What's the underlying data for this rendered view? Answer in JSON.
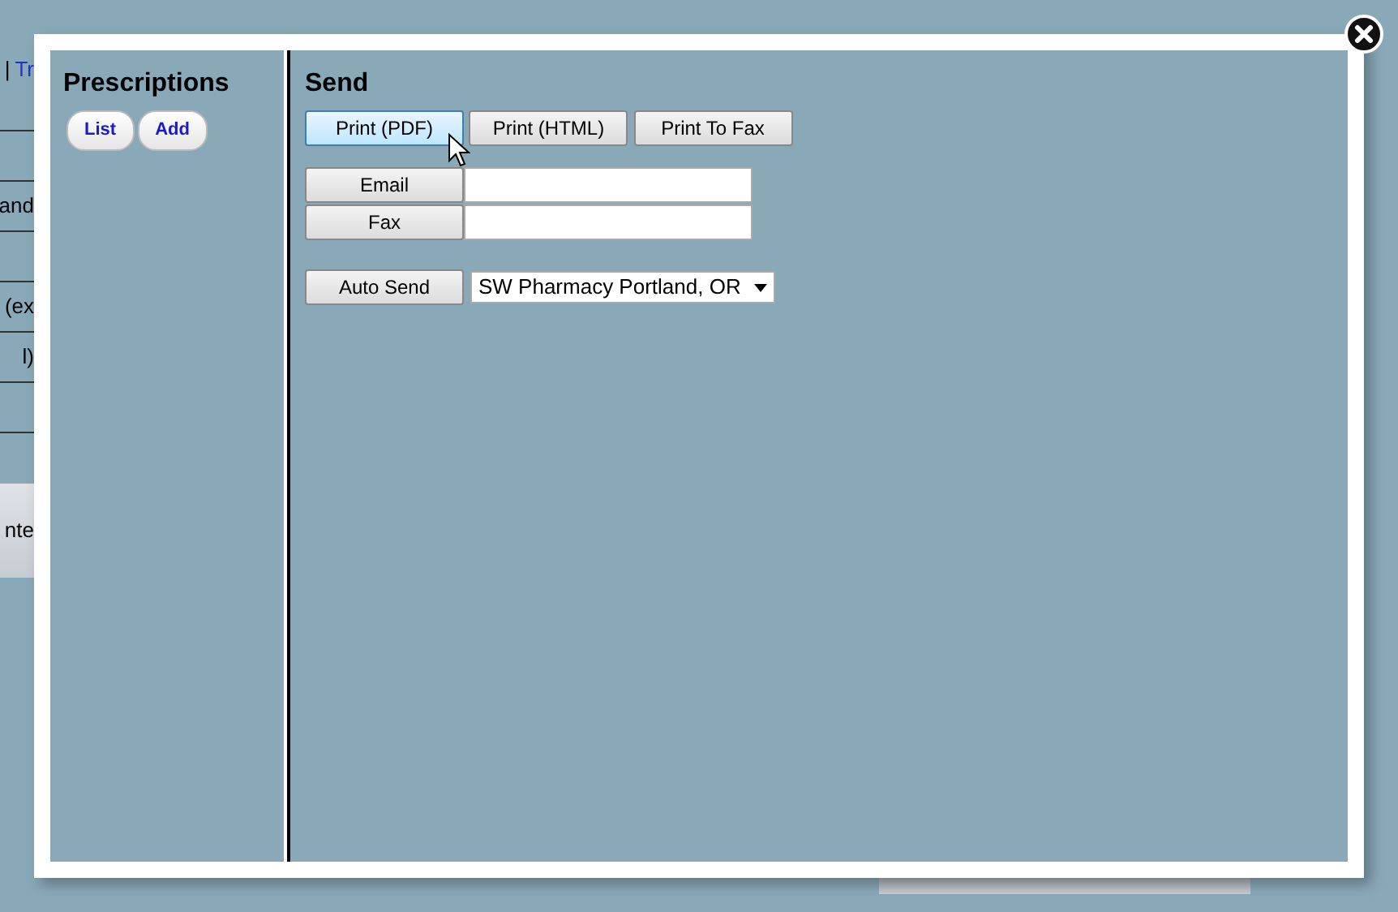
{
  "background_page": {
    "link_separator": "|",
    "link": "Tr",
    "rows": [
      {},
      {
        "text": "and"
      },
      {},
      {
        "text": "(ex"
      },
      {
        "text": "l)"
      },
      {}
    ],
    "footer_text": "nte"
  },
  "sidebar": {
    "title": "Prescriptions",
    "buttons": [
      {
        "label": "List"
      },
      {
        "label": "Add"
      }
    ]
  },
  "send": {
    "title": "Send",
    "print_buttons": [
      {
        "label": "Print (PDF)",
        "hovered": true
      },
      {
        "label": "Print (HTML)",
        "hovered": false
      },
      {
        "label": "Print To Fax",
        "hovered": false
      }
    ],
    "fields": [
      {
        "button": "Email"
      },
      {
        "button": "Fax"
      }
    ],
    "auto_send": {
      "button": "Auto Send",
      "selected_option": "SW Pharmacy Portland, OR"
    }
  }
}
